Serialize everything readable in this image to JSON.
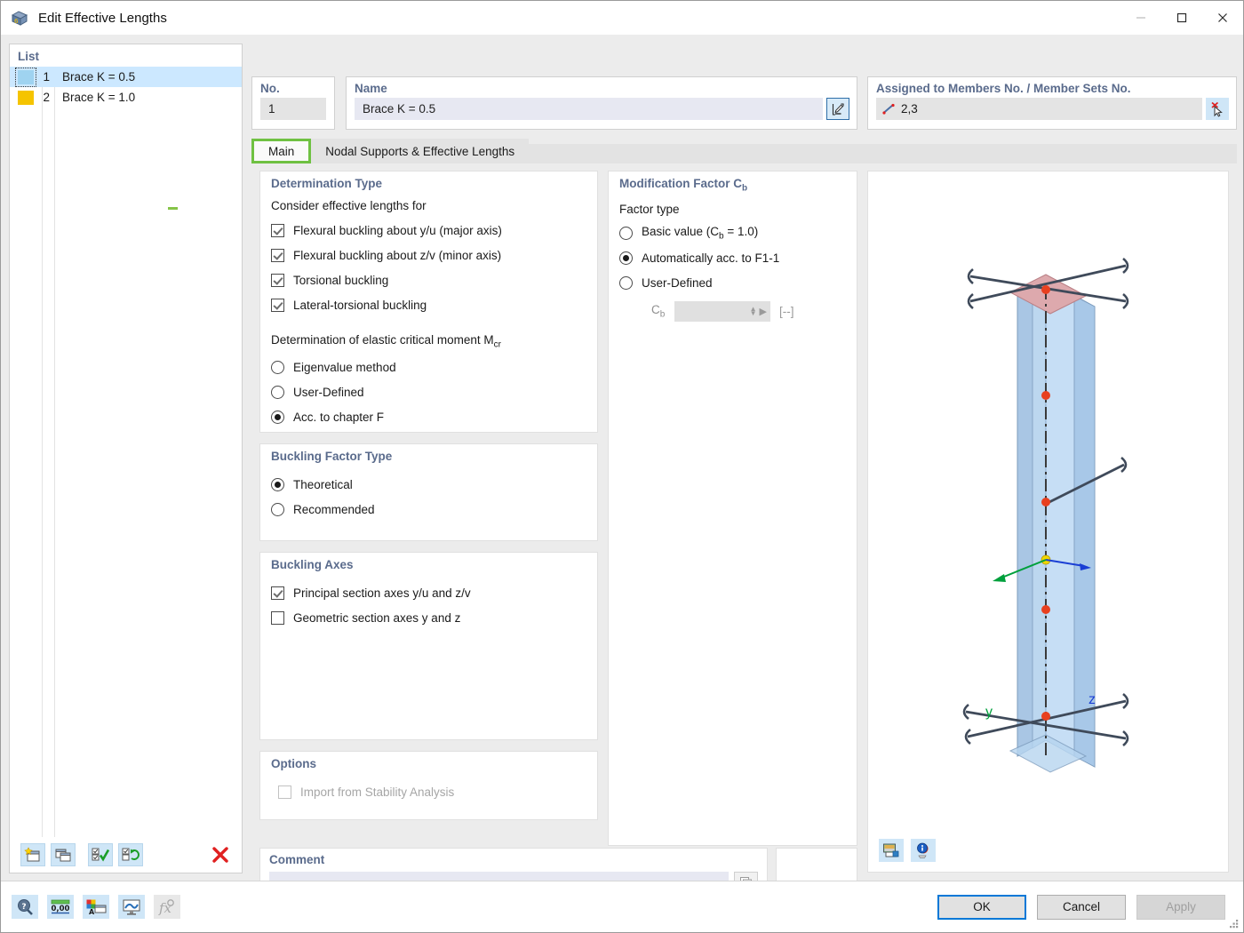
{
  "window": {
    "title": "Edit Effective Lengths",
    "icon": "app-cube-icon",
    "minimize": "—",
    "maximize": "▢",
    "close": "✕"
  },
  "list_panel": {
    "header": "List",
    "rows": [
      {
        "no": "1",
        "label": "Brace K = 0.5",
        "color": "#9fd3f0",
        "selected": true
      },
      {
        "no": "2",
        "label": "Brace K = 1.0",
        "color": "#f5c400",
        "selected": false
      }
    ],
    "toolbar": [
      {
        "name": "new-item-button",
        "glyph": "new"
      },
      {
        "name": "copy-item-button",
        "glyph": "copy"
      },
      {
        "name": "select-all-button",
        "glyph": "checkall"
      },
      {
        "name": "invert-selection-button",
        "glyph": "invert"
      },
      {
        "name": "delete-item-button",
        "glyph": "delete"
      }
    ]
  },
  "no_panel": {
    "label": "No.",
    "value": "1"
  },
  "name_panel": {
    "label": "Name",
    "value": "Brace K = 0.5",
    "edit_button": "edit-pencil-icon"
  },
  "assigned_panel": {
    "label": "Assigned to Members No. / Member Sets No.",
    "value": "2,3",
    "pick_button": "pick-members-icon"
  },
  "tabs": [
    {
      "label": "Main",
      "active": true
    },
    {
      "label": "Nodal Supports & Effective Lengths",
      "active": false
    }
  ],
  "determination_type": {
    "title": "Determination Type",
    "consider_label": "Consider effective lengths for",
    "checkboxes": [
      {
        "label": "Flexural buckling about y/u (major axis)",
        "checked": true
      },
      {
        "label": "Flexural buckling about z/v (minor axis)",
        "checked": true
      },
      {
        "label": "Torsional buckling",
        "checked": true
      },
      {
        "label": "Lateral-torsional buckling",
        "checked": true
      }
    ],
    "mcr_label": "Determination of elastic critical moment Mcr",
    "mcr_label_base": "Determination of elastic critical moment M",
    "mcr_label_sub": "cr",
    "radios": [
      {
        "label": "Eigenvalue method",
        "selected": false
      },
      {
        "label": "User-Defined",
        "selected": false
      },
      {
        "label": "Acc. to chapter F",
        "selected": true
      }
    ]
  },
  "buckling_factor_type": {
    "title": "Buckling Factor Type",
    "radios": [
      {
        "label": "Theoretical",
        "selected": true
      },
      {
        "label": "Recommended",
        "selected": false
      }
    ]
  },
  "buckling_axes": {
    "title": "Buckling Axes",
    "checkboxes": [
      {
        "label": "Principal section axes y/u and z/v",
        "checked": true
      },
      {
        "label": "Geometric section axes y and z",
        "checked": false
      }
    ]
  },
  "options": {
    "title": "Options",
    "checkboxes": [
      {
        "label": "Import from Stability Analysis",
        "checked": false,
        "disabled": true
      }
    ]
  },
  "modification_factor": {
    "title_base": "Modification Factor C",
    "title_sub": "b",
    "factor_type_label": "Factor type",
    "radios": [
      {
        "label": "Basic value (Cb = 1.0)",
        "label_base": "Basic value (C",
        "label_sub": "b",
        "label_tail": " = 1.0)",
        "selected": false
      },
      {
        "label": "Automatically acc. to F1-1",
        "selected": true
      },
      {
        "label": "User-Defined",
        "selected": false
      }
    ],
    "cb_field": {
      "label_base": "C",
      "label_sub": "b",
      "value": "",
      "unit": "[--]",
      "disabled": true
    }
  },
  "comment": {
    "title": "Comment",
    "value": "",
    "placeholder": "",
    "dropdown_icon": "chevron-down-icon",
    "copy_button": "copy-comment-icon"
  },
  "viewport": {
    "axes": [
      {
        "label": "y",
        "color": "#00a03c"
      },
      {
        "label": "z",
        "color": "#1b3fd4"
      }
    ],
    "toolbar": [
      {
        "name": "render-view-button",
        "glyph": "render"
      },
      {
        "name": "info-button",
        "glyph": "info"
      }
    ]
  },
  "footer": {
    "tools": [
      {
        "name": "help-button",
        "glyph": "help"
      },
      {
        "name": "number-format-button",
        "glyph": "0,00"
      },
      {
        "name": "appearance-button",
        "glyph": "colors"
      },
      {
        "name": "display-settings-button",
        "glyph": "display"
      },
      {
        "name": "formula-button",
        "glyph": "fx",
        "disabled": true
      }
    ],
    "buttons": [
      {
        "label": "OK",
        "style": "primary"
      },
      {
        "label": "Cancel",
        "style": "normal"
      },
      {
        "label": "Apply",
        "style": "disabled"
      }
    ]
  },
  "colors": {
    "group_title": "#5a6b8c",
    "tab_active_border": "#6fc142",
    "selection": "#cce8ff",
    "primary_border": "#0078d7",
    "delete_red": "#e02020",
    "node_red": "#e8401f",
    "node_yellow": "#f2d600"
  }
}
